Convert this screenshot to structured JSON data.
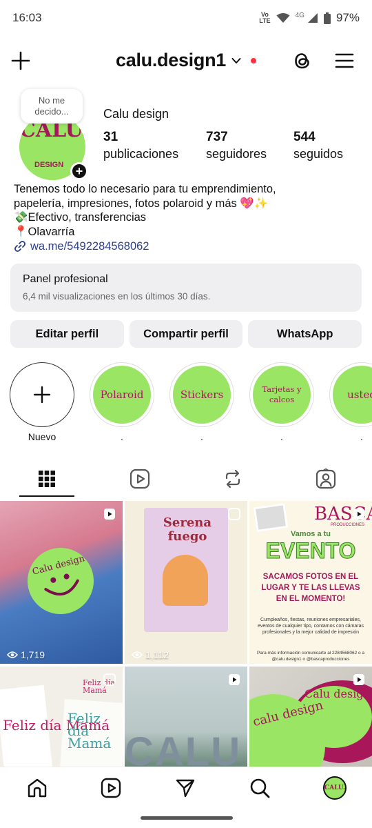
{
  "status_bar": {
    "time": "16:03",
    "volte": "Vo\nLTE",
    "network": "4G",
    "battery": "97%"
  },
  "header": {
    "username": "calu.design1"
  },
  "profile": {
    "note": "No me decido...",
    "display_name": "Calu design",
    "avatar_text": "CALU.",
    "avatar_sub": "DESIGN",
    "stats": [
      {
        "value": "31",
        "label": "publicaciones"
      },
      {
        "value": "737",
        "label": "seguidores"
      },
      {
        "value": "544",
        "label": "seguidos"
      }
    ]
  },
  "bio": {
    "line1": "Tenemos todo lo necesario para tu emprendimiento,",
    "line2": "papelería, impresiones, fotos polaroid y más 💖✨",
    "line3": "💸Efectivo, transferencias",
    "line4": "📍Olavarría",
    "link": "wa.me/5492284568062"
  },
  "panel": {
    "title": "Panel profesional",
    "subtitle": "6,4 mil visualizaciones en los últimos 30 días."
  },
  "buttons": {
    "edit": "Editar perfil",
    "share": "Compartir perfil",
    "whatsapp": "WhatsApp"
  },
  "highlights": [
    {
      "label": "Nuevo",
      "title": ""
    },
    {
      "label": ".",
      "title": "Polaroid"
    },
    {
      "label": ".",
      "title": "Stickers"
    },
    {
      "label": ".",
      "title": "Tarjetas y calcos"
    },
    {
      "label": ".",
      "title": "usted"
    }
  ],
  "grid": {
    "post1": {
      "views": "1,719",
      "text": "Calu design"
    },
    "post2": {
      "views": "1,112",
      "title": "Serena fuego"
    },
    "post3": {
      "brand": "BASCA",
      "brand_sub": "PRODUCCIONES",
      "vamos": "Vamos a tu",
      "evento": "EVENTO",
      "headline": "SACAMOS FOTOS EN EL LUGAR Y TE LAS LLEVAS EN EL MOMENTO!",
      "fine": "Cumpleaños, fiestas, reuniones empresariales, eventos de cualquier tipo, contamos con cámaras profesionales y la mejor calidad de impresión",
      "fine2": "Para más información comunicarte al 2284568062 o a @calu.design1 o @bascaproducciones"
    },
    "post4": {
      "text_a": "Feliz día Mamá",
      "text_b": "Feliz día Mamá",
      "text_c": "Feliz día Mamá"
    },
    "post5": {
      "text": "CALU"
    },
    "post6": {
      "text_a": "Calu design",
      "text_b": "calu design"
    }
  },
  "colors": {
    "brand_green": "#9be564",
    "brand_magenta": "#a3195b",
    "link_blue": "#2b3f8e",
    "notification_red": "#ff3040"
  }
}
